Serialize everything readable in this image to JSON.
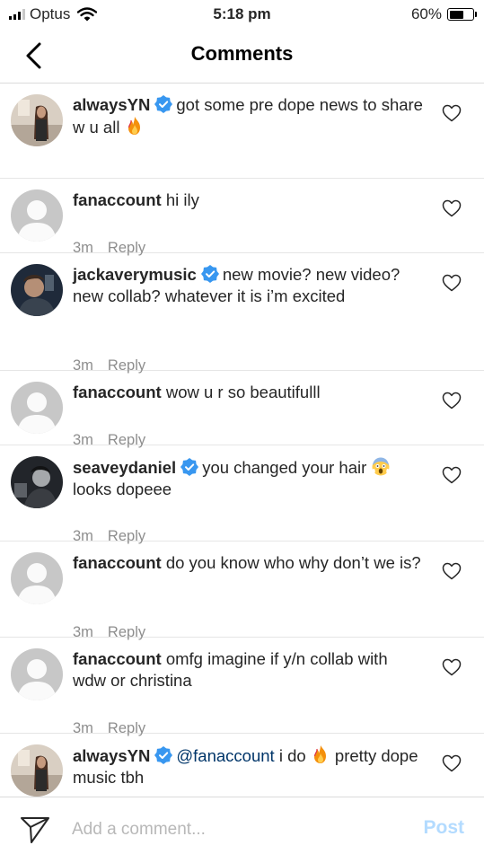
{
  "status_bar": {
    "carrier": "Optus",
    "time": "5:18 pm",
    "battery": "60%",
    "battery_level": 0.6,
    "signal_bars": 3
  },
  "header": {
    "title": "Comments"
  },
  "comments": [
    {
      "user": "alwaysYN",
      "verified": true,
      "avatar": "photo",
      "segments": [
        {
          "t": "got some pre dope news to share w u all "
        },
        {
          "e": "fire"
        }
      ],
      "time": "",
      "reply": ""
    },
    {
      "user": "fanaccount",
      "verified": false,
      "avatar": "default",
      "segments": [
        {
          "t": "hi ily"
        }
      ],
      "time": "3m",
      "reply": "Reply"
    },
    {
      "user": "jackaverymusic",
      "verified": true,
      "avatar": "photo",
      "segments": [
        {
          "t": "new movie? new video? new collab? whatever it is i’m excited"
        }
      ],
      "time": "3m",
      "reply": "Reply"
    },
    {
      "user": "fanaccount",
      "verified": false,
      "avatar": "default",
      "segments": [
        {
          "t": "wow u r so beautifulll"
        }
      ],
      "time": "3m",
      "reply": "Reply"
    },
    {
      "user": "seaveydaniel",
      "verified": true,
      "avatar": "photo",
      "segments": [
        {
          "t": "you changed your hair "
        },
        {
          "e": "scream"
        },
        {
          "t": " looks dopeee"
        }
      ],
      "time": "3m",
      "reply": "Reply"
    },
    {
      "user": "fanaccount",
      "verified": false,
      "avatar": "default",
      "segments": [
        {
          "t": "do you know who why don’t we is?"
        }
      ],
      "time": "3m",
      "reply": "Reply"
    },
    {
      "user": "fanaccount",
      "verified": false,
      "avatar": "default",
      "segments": [
        {
          "t": "omfg imagine if y/n collab with wdw or christina"
        }
      ],
      "time": "3m",
      "reply": "Reply"
    },
    {
      "user": "alwaysYN",
      "verified": true,
      "avatar": "photo",
      "segments": [
        {
          "m": "@fanaccount"
        },
        {
          "t": " i do "
        },
        {
          "e": "fire"
        },
        {
          "t": " pretty dope music tbh"
        }
      ],
      "time": "",
      "reply": ""
    }
  ],
  "composer": {
    "placeholder": "Add a comment...",
    "post_label": "Post"
  },
  "colors": {
    "verified": "#3897f0",
    "mention": "#003569",
    "post_disabled": "#b3dbff",
    "meta": "#8e8e8e"
  }
}
